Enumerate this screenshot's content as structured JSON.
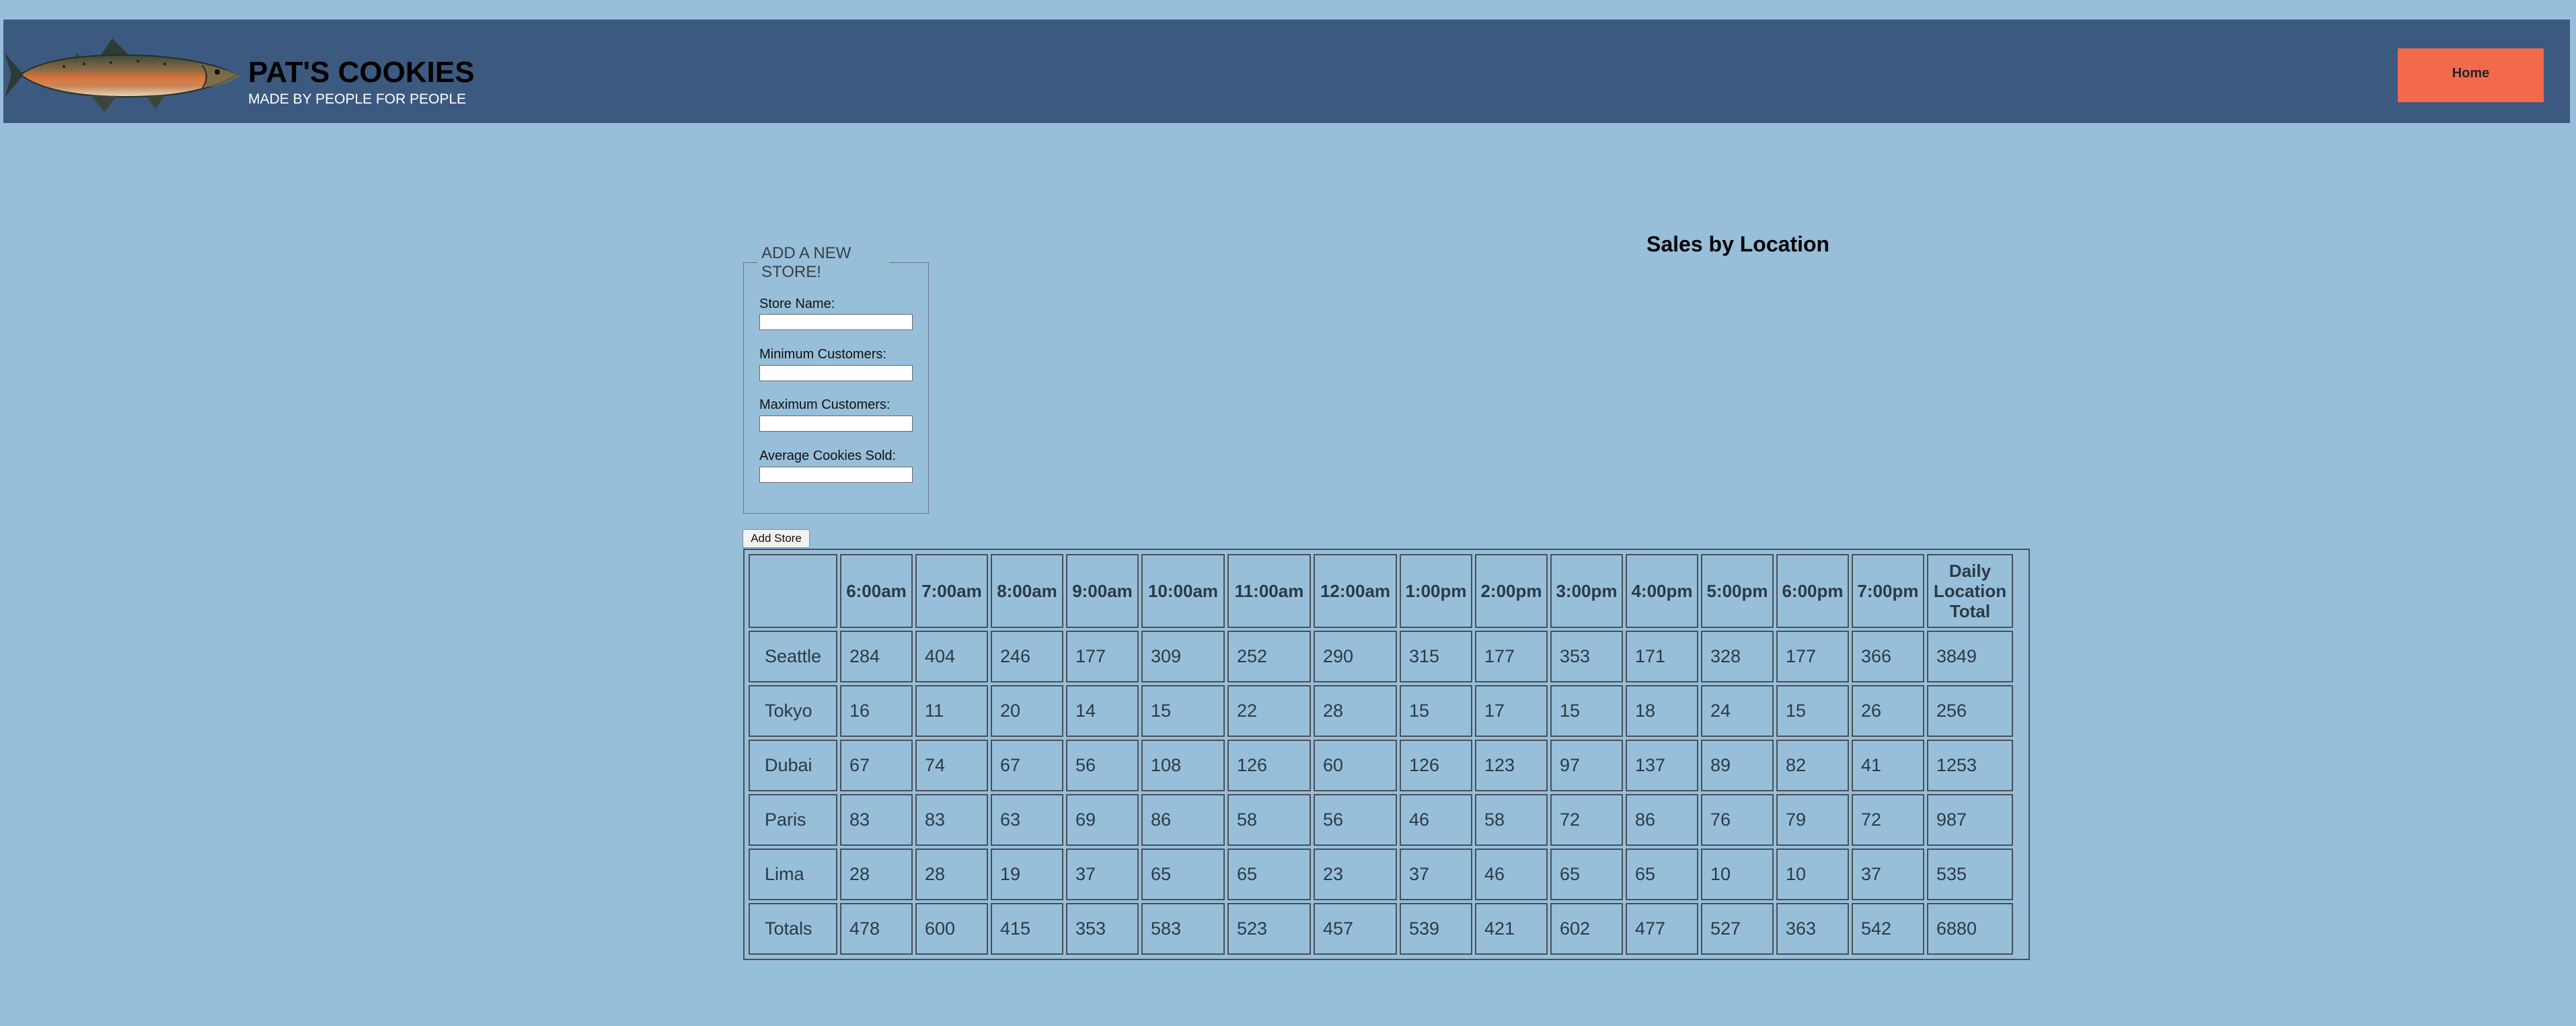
{
  "header": {
    "brand_title": "PAT'S COOKIES",
    "brand_subtitle": "MADE BY PEOPLE FOR PEOPLE",
    "logo_icon": "salmon-fish-icon",
    "nav": {
      "home_label": "Home"
    },
    "colors": {
      "header_bg": "#3c5a80",
      "page_bg": "#97bfd9",
      "home_bg": "#f26a4b"
    }
  },
  "form": {
    "legend": "ADD A NEW STORE!",
    "fields": [
      {
        "label": "Store Name:",
        "value": ""
      },
      {
        "label": "Minimum Customers:",
        "value": ""
      },
      {
        "label": "Maximum Customers:",
        "value": ""
      },
      {
        "label": "Average Cookies Sold:",
        "value": ""
      }
    ],
    "submit_label": "Add Store"
  },
  "sales": {
    "title": "Sales by Location",
    "columns": [
      "",
      "6:00am",
      "7:00am",
      "8:00am",
      "9:00am",
      "10:00am",
      "11:00am",
      "12:00am",
      "1:00pm",
      "2:00pm",
      "3:00pm",
      "4:00pm",
      "5:00pm",
      "6:00pm",
      "7:00pm",
      "Daily Location Total"
    ],
    "rows": [
      {
        "store": "Seattle",
        "values": [
          "284",
          "404",
          "246",
          "177",
          "309",
          "252",
          "290",
          "315",
          "177",
          "353",
          "171",
          "328",
          "177",
          "366",
          "3849"
        ]
      },
      {
        "store": "Tokyo",
        "values": [
          "16",
          "11",
          "20",
          "14",
          "15",
          "22",
          "28",
          "15",
          "17",
          "15",
          "18",
          "24",
          "15",
          "26",
          "256"
        ]
      },
      {
        "store": "Dubai",
        "values": [
          "67",
          "74",
          "67",
          "56",
          "108",
          "126",
          "60",
          "126",
          "123",
          "97",
          "137",
          "89",
          "82",
          "41",
          "1253"
        ]
      },
      {
        "store": "Paris",
        "values": [
          "83",
          "83",
          "63",
          "69",
          "86",
          "58",
          "56",
          "46",
          "58",
          "72",
          "86",
          "76",
          "79",
          "72",
          "987"
        ]
      },
      {
        "store": "Lima",
        "values": [
          "28",
          "28",
          "19",
          "37",
          "65",
          "65",
          "23",
          "37",
          "46",
          "65",
          "65",
          "10",
          "10",
          "37",
          "535"
        ]
      }
    ],
    "totals": {
      "label": "Totals",
      "values": [
        "478",
        "600",
        "415",
        "353",
        "583",
        "523",
        "457",
        "539",
        "421",
        "602",
        "477",
        "527",
        "363",
        "542",
        "6880"
      ]
    }
  }
}
